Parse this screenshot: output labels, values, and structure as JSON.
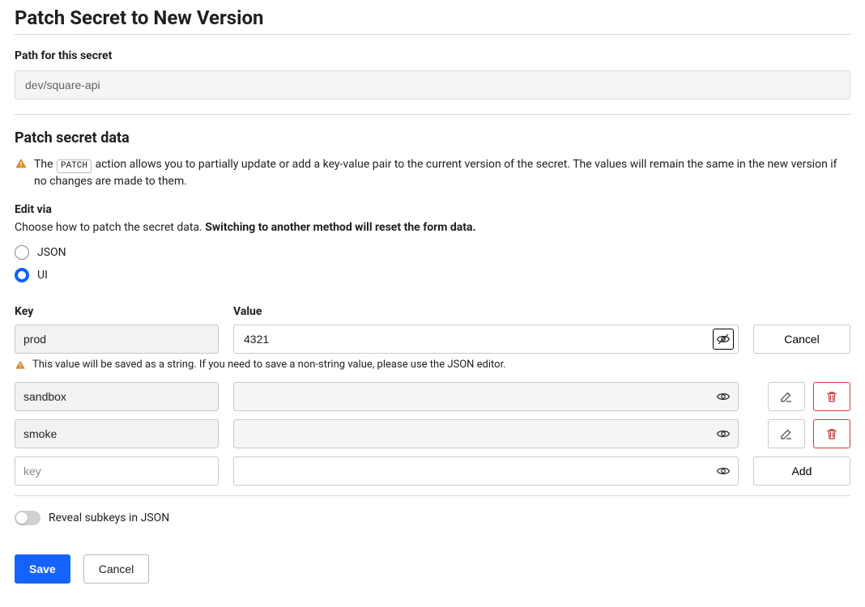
{
  "page_title": "Patch Secret to New Version",
  "path_field": {
    "label": "Path for this secret",
    "value": "dev/square-api"
  },
  "data_section": {
    "title": "Patch secret data",
    "info_prefix": "The",
    "info_badge": "PATCH",
    "info_suffix": "action allows you to partially update or add a key-value pair to the current version of the secret. The values will remain the same in the new version if no changes are made to them."
  },
  "edit_via": {
    "label": "Edit via",
    "help_text": "Choose how to patch the secret data.",
    "help_strong": "Switching to another method will reset the form data.",
    "options": [
      {
        "label": "JSON",
        "selected": false
      },
      {
        "label": "UI",
        "selected": true
      }
    ]
  },
  "kv_headers": {
    "key": "Key",
    "value": "Value"
  },
  "rows": {
    "editing": {
      "key": "prod",
      "value": "4321",
      "action_label": "Cancel"
    },
    "warning_text": "This value will be saved as a string. If you need to save a non-string value, please use the JSON editor.",
    "existing": [
      {
        "key": "sandbox",
        "value": ""
      },
      {
        "key": "smoke",
        "value": ""
      }
    ],
    "new": {
      "key_placeholder": "key",
      "value": "",
      "action_label": "Add"
    }
  },
  "toggle": {
    "label": "Reveal subkeys in JSON",
    "on": false
  },
  "footer": {
    "save": "Save",
    "cancel": "Cancel"
  }
}
